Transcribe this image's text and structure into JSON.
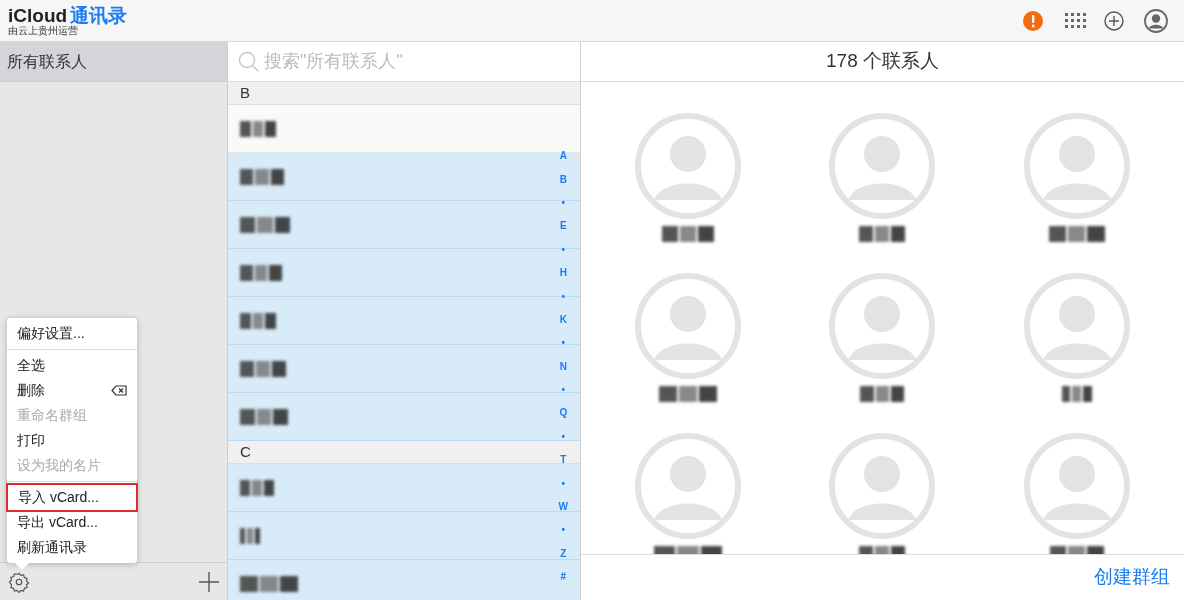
{
  "header": {
    "brand": "iCloud",
    "app": "通讯录",
    "operator": "由云上贵州运营"
  },
  "sidebar": {
    "groups": [
      {
        "label": "所有联系人",
        "selected": true
      }
    ]
  },
  "menu": {
    "items": [
      {
        "label": "偏好设置...",
        "disabled": false,
        "highlighted": false,
        "separator_after": true
      },
      {
        "label": "全选",
        "disabled": false,
        "highlighted": false,
        "separator_after": false
      },
      {
        "label": "删除",
        "disabled": false,
        "highlighted": false,
        "separator_after": false,
        "kind": "delete"
      },
      {
        "label": "重命名群组",
        "disabled": true,
        "highlighted": false,
        "separator_after": false
      },
      {
        "label": "打印",
        "disabled": false,
        "highlighted": false,
        "separator_after": false
      },
      {
        "label": "设为我的名片",
        "disabled": true,
        "highlighted": false,
        "separator_after": true
      },
      {
        "label": "导入 vCard...",
        "disabled": false,
        "highlighted": true,
        "separator_after": false
      },
      {
        "label": "导出 vCard...",
        "disabled": false,
        "highlighted": false,
        "separator_after": false
      },
      {
        "label": "刷新通讯录",
        "disabled": false,
        "highlighted": false,
        "separator_after": false
      }
    ]
  },
  "search": {
    "placeholder": "搜索\"所有联系人\""
  },
  "sections": [
    {
      "letter": "B",
      "contacts": [
        {
          "selected": false
        },
        {
          "selected": true
        },
        {
          "selected": true
        },
        {
          "selected": true
        },
        {
          "selected": true
        },
        {
          "selected": true
        },
        {
          "selected": true
        }
      ]
    },
    {
      "letter": "C",
      "contacts": [
        {
          "selected": true
        },
        {
          "selected": true
        },
        {
          "selected": true
        }
      ]
    }
  ],
  "index": [
    "A",
    "B",
    "•",
    "E",
    "•",
    "H",
    "•",
    "K",
    "•",
    "N",
    "•",
    "Q",
    "•",
    "T",
    "•",
    "W",
    "•",
    "Z",
    "#"
  ],
  "detail": {
    "title": "178 个联系人",
    "cards": [
      {
        "kind": "contact"
      },
      {
        "kind": "contact"
      },
      {
        "kind": "contact"
      },
      {
        "kind": "contact"
      },
      {
        "kind": "contact"
      },
      {
        "kind": "contact"
      },
      {
        "kind": "contact"
      },
      {
        "kind": "contact"
      },
      {
        "kind": "contact"
      }
    ],
    "create_group": "创建群组"
  }
}
